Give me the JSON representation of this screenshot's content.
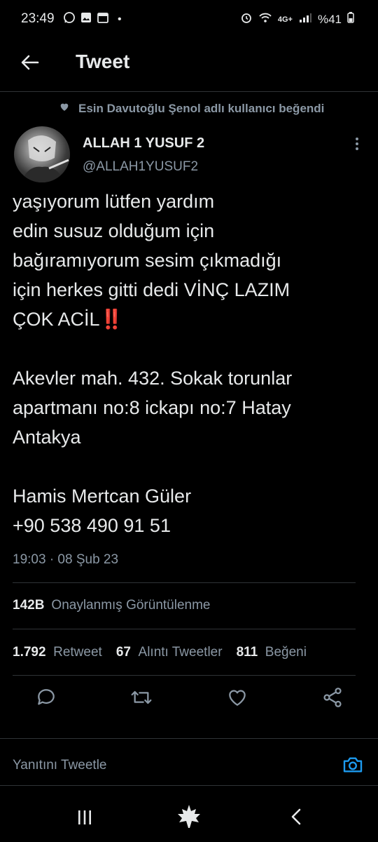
{
  "status_bar": {
    "time": "23:49",
    "battery": "%41",
    "dot": "•",
    "network_label": "4G+"
  },
  "header": {
    "title": "Tweet"
  },
  "social_context": {
    "text": "Esin Davutoğlu Şenol adlı kullanıcı beğendi"
  },
  "author": {
    "name": "ALLAH 1 YUSUF 2",
    "handle": "@ALLAH1YUSUF2"
  },
  "tweet": {
    "text": "yaşıyorum lütfen yardım\nedin susuz olduğum için\nbağıramıyorum sesim çıkmadığı\niçin herkes gitti dedi VİNÇ LAZIM\nÇOK ACİL‼️\n\nAkevler mah. 432. Sokak torunlar\napartmanı no:8 ickapı no:7 Hatay\nAntakya\n\nHamis Mertcan Güler\n+90 538 490 91 51",
    "timestamp": "19:03 · 08 Şub 23"
  },
  "views": {
    "count": "142B",
    "label": "Onaylanmış Görüntülenme"
  },
  "engagement": {
    "retweets_count": "1.792",
    "retweets_label": "Retweet",
    "quotes_count": "67",
    "quotes_label": "Alıntı Tweetler",
    "likes_count": "811",
    "likes_label": "Beğeni"
  },
  "reply": {
    "placeholder": "Yanıtını Tweetle"
  },
  "colors": {
    "accent": "#1d9bf0",
    "muted": "#8b98a5",
    "text": "#e7e9ea",
    "border": "#2f3336",
    "emoji_red": "#e0245e"
  },
  "icons": {
    "back": "arrow-left-icon",
    "heart_small": "heart-icon",
    "more": "more-vertical-icon",
    "reply": "reply-icon",
    "retweet": "retweet-icon",
    "like": "heart-outline-icon",
    "share": "share-icon",
    "camera": "camera-icon"
  }
}
